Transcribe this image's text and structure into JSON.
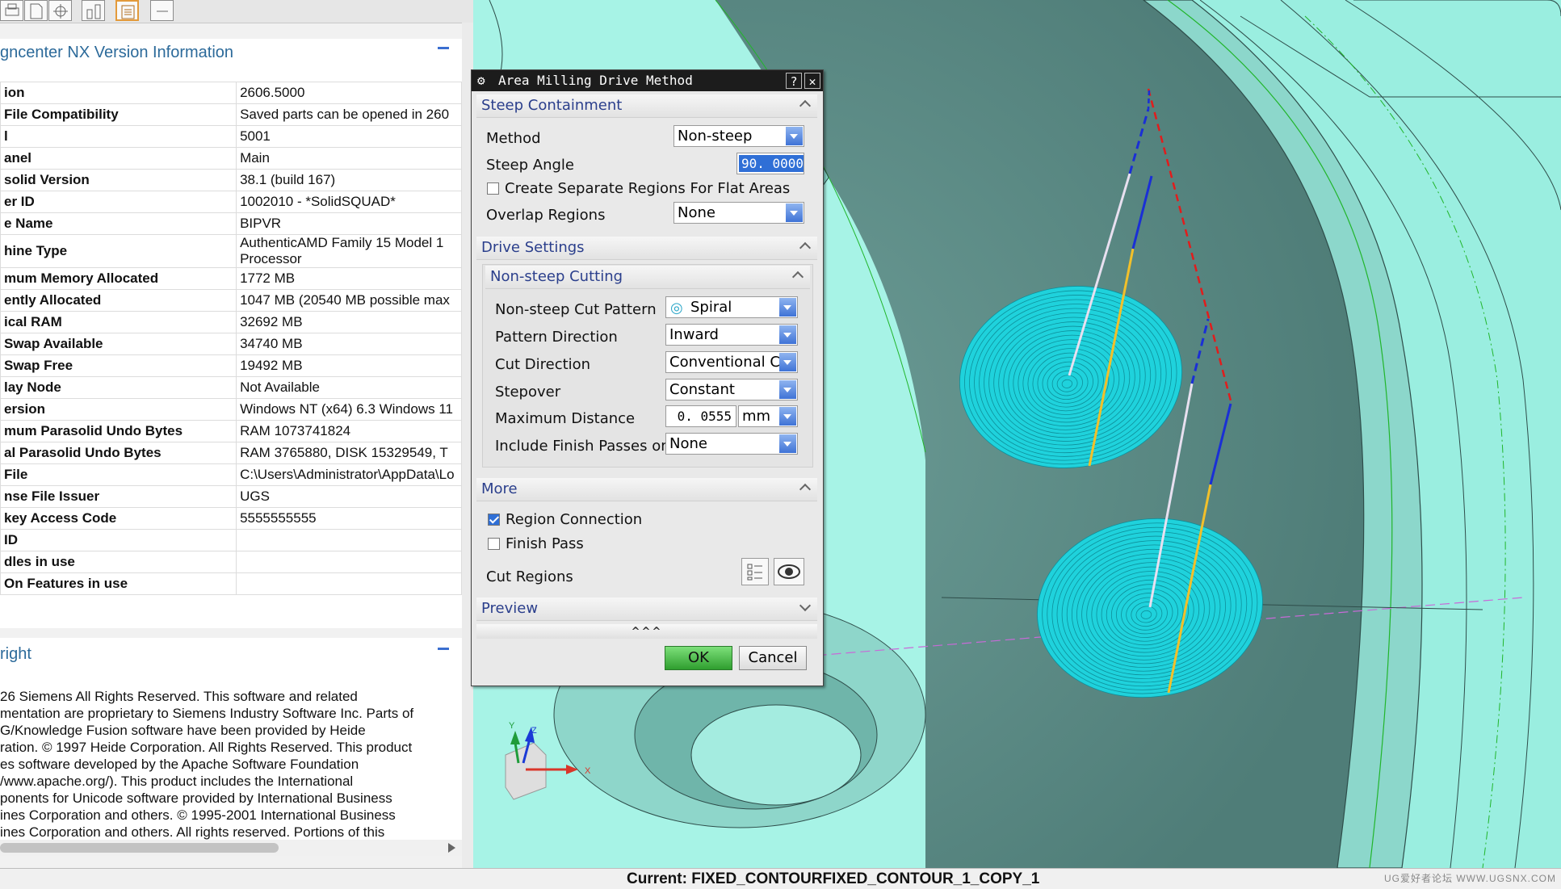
{
  "toolbar": {
    "icons": [
      "print-icon",
      "page-icon",
      "crosshair-icon",
      "tools-icon",
      "report-icon",
      "minus-icon"
    ]
  },
  "version_info": {
    "title": "gncenter NX Version Information",
    "rows": [
      {
        "key": "ion",
        "value": "2606.5000"
      },
      {
        "key": "File Compatibility",
        "value": "Saved parts can be opened in 260"
      },
      {
        "key": "l",
        "value": "5001"
      },
      {
        "key": "anel",
        "value": "Main"
      },
      {
        "key": "solid Version",
        "value": "38.1 (build 167)"
      },
      {
        "key": "er ID",
        "value": "1002010 - *SolidSQUAD*"
      },
      {
        "key": "e Name",
        "value": "BIPVR"
      },
      {
        "key": "hine Type",
        "value": "AuthenticAMD Family 15 Model 1 \nProcessor"
      },
      {
        "key": "mum Memory Allocated",
        "value": "1772 MB"
      },
      {
        "key": "ently Allocated",
        "value": "1047 MB (20540 MB possible max"
      },
      {
        "key": "ical RAM",
        "value": "32692 MB"
      },
      {
        "key": " Swap Available",
        "value": "34740 MB"
      },
      {
        "key": " Swap Free",
        "value": "19492 MB"
      },
      {
        "key": "lay Node",
        "value": "Not Available"
      },
      {
        "key": "ersion",
        "value": "Windows NT (x64) 6.3 Windows 11"
      },
      {
        "key": "mum Parasolid Undo Bytes",
        "value": "RAM 1073741824"
      },
      {
        "key": "al Parasolid Undo Bytes",
        "value": "RAM 3765880, DISK 15329549, T"
      },
      {
        "key": "File",
        "value": "C:\\Users\\Administrator\\AppData\\Lo"
      },
      {
        "key": "nse File Issuer",
        "value": "UGS"
      },
      {
        "key": "key Access Code",
        "value": "5555555555"
      },
      {
        "key": "ID",
        "value": ""
      },
      {
        "key": "dles in use",
        "value": ""
      },
      {
        "key": "On Features in use",
        "value": ""
      }
    ]
  },
  "copyright": {
    "title": "right",
    "text": "26 Siemens All Rights Reserved. This software and related\nmentation are proprietary to Siemens Industry Software Inc. Parts of\nG/Knowledge Fusion software have been provided by Heide\nration. © 1997 Heide Corporation. All Rights Reserved. This product\nes software developed by the Apache Software Foundation\n/www.apache.org/). This product includes the International\nponents for Unicode software provided by International Business\nines Corporation and others. © 1995-2001 International Business\nines Corporation and others. All rights reserved. Portions of this"
  },
  "dialog": {
    "title": "Area Milling Drive Method",
    "help": "?",
    "close": "✕",
    "steep_containment": {
      "header": "Steep Containment",
      "method_label": "Method",
      "method_value": "Non-steep",
      "steep_angle_label": "Steep Angle",
      "steep_angle_value": "90. 0000",
      "separate_regions_label": "Create Separate Regions For Flat Areas",
      "overlap_label": "Overlap Regions",
      "overlap_value": "None"
    },
    "drive_settings": {
      "header": "Drive Settings",
      "sub_header": "Non-steep Cutting",
      "cut_pattern_label": "Non-steep Cut Pattern",
      "cut_pattern_value": "Spiral",
      "pattern_direction_label": "Pattern Direction",
      "pattern_direction_value": "Inward",
      "cut_direction_label": "Cut Direction",
      "cut_direction_value": "Conventional Cut",
      "stepover_label": "Stepover",
      "stepover_value": "Constant",
      "max_distance_label": "Maximum Distance",
      "max_distance_value": "0. 0555",
      "max_distance_unit": "mm",
      "finish_passes_label": "Include Finish Passes on",
      "finish_passes_value": "None"
    },
    "more": {
      "header": "More",
      "region_connection_label": "Region Connection",
      "finish_pass_label": "Finish Pass",
      "cut_regions_label": "Cut Regions"
    },
    "preview": {
      "header": "Preview",
      "expand": "^^^"
    },
    "ok": "OK",
    "cancel": "Cancel"
  },
  "triad": {
    "x": "X",
    "y": "Y",
    "z": "Z"
  },
  "status": {
    "current": "Current: FIXED_CONTOURFIXED_CONTOUR_1_COPY_1",
    "watermark": "UG爱好者论坛 WWW.UGSNX.COM"
  },
  "colors": {
    "part": "#9aeee0",
    "spiral": "#24d8e0",
    "dialog_blue": "#2b3f8c",
    "ok_green": "#2f9e2f"
  }
}
